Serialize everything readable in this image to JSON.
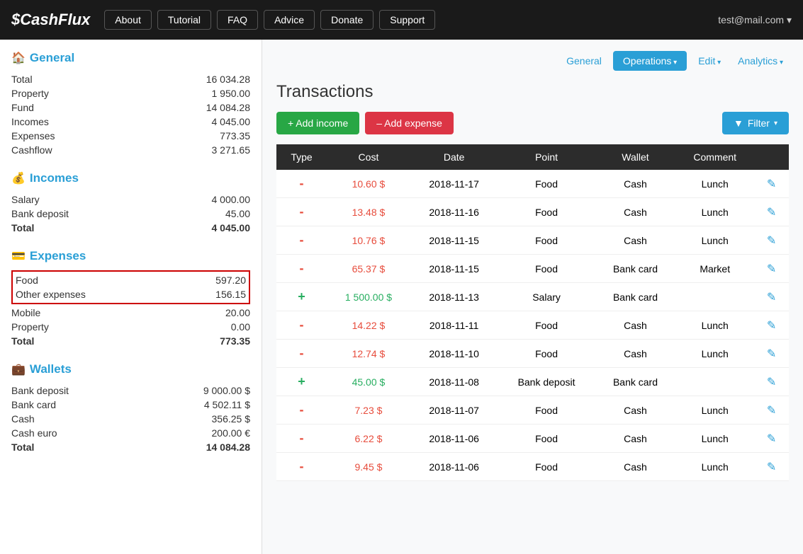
{
  "header": {
    "logo_symbol": "$",
    "logo_text": "CashFlux",
    "nav_items": [
      "About",
      "Tutorial",
      "FAQ",
      "Advice",
      "Donate",
      "Support"
    ],
    "user_email": "test@mail.com"
  },
  "top_nav": {
    "general_label": "General",
    "operations_label": "Operations",
    "edit_label": "Edit",
    "analytics_label": "Analytics"
  },
  "sidebar": {
    "general_title": "General",
    "general_icon": "🏠",
    "general_rows": [
      {
        "label": "Total",
        "value": "16 034.28"
      },
      {
        "label": "Property",
        "value": "1 950.00"
      },
      {
        "label": "Fund",
        "value": "14 084.28"
      },
      {
        "label": "Incomes",
        "value": "4 045.00"
      },
      {
        "label": "Expenses",
        "value": "773.35"
      },
      {
        "label": "Cashflow",
        "value": "3 271.65"
      }
    ],
    "incomes_title": "Incomes",
    "incomes_icon": "💰",
    "incomes_rows": [
      {
        "label": "Salary",
        "value": "4 000.00"
      },
      {
        "label": "Bank deposit",
        "value": "45.00"
      },
      {
        "label": "Total",
        "value": "4 045.00",
        "bold": true
      }
    ],
    "expenses_title": "Expenses",
    "expenses_icon": "💳",
    "expenses_rows": [
      {
        "label": "Food",
        "value": "597.20",
        "highlight": true
      },
      {
        "label": "Other expenses",
        "value": "156.15",
        "highlight": true
      },
      {
        "label": "Mobile",
        "value": "20.00"
      },
      {
        "label": "Property",
        "value": "0.00"
      },
      {
        "label": "Total",
        "value": "773.35",
        "bold": true
      }
    ],
    "wallets_title": "Wallets",
    "wallets_icon": "💼",
    "wallets_rows": [
      {
        "label": "Bank deposit",
        "value": "9 000.00 $"
      },
      {
        "label": "Bank card",
        "value": "4 502.11 $"
      },
      {
        "label": "Cash",
        "value": "356.25 $"
      },
      {
        "label": "Cash euro",
        "value": "200.00 €"
      },
      {
        "label": "Total",
        "value": "14 084.28",
        "bold": true
      }
    ]
  },
  "transactions": {
    "title": "Transactions",
    "add_income_label": "+ Add income",
    "add_expense_label": "– Add expense",
    "filter_label": "Filter",
    "columns": [
      "Type",
      "Cost",
      "Date",
      "Point",
      "Wallet",
      "Comment"
    ],
    "rows": [
      {
        "type": "-",
        "cost": "10.60 $",
        "cost_type": "negative",
        "date": "2018-11-17",
        "point": "Food",
        "wallet": "Cash",
        "comment": "Lunch"
      },
      {
        "type": "-",
        "cost": "13.48 $",
        "cost_type": "negative",
        "date": "2018-11-16",
        "point": "Food",
        "wallet": "Cash",
        "comment": "Lunch"
      },
      {
        "type": "-",
        "cost": "10.76 $",
        "cost_type": "negative",
        "date": "2018-11-15",
        "point": "Food",
        "wallet": "Cash",
        "comment": "Lunch"
      },
      {
        "type": "-",
        "cost": "65.37 $",
        "cost_type": "negative",
        "date": "2018-11-15",
        "point": "Food",
        "wallet": "Bank card",
        "comment": "Market"
      },
      {
        "type": "+",
        "cost": "1 500.00 $",
        "cost_type": "positive",
        "date": "2018-11-13",
        "point": "Salary",
        "wallet": "Bank card",
        "comment": ""
      },
      {
        "type": "-",
        "cost": "14.22 $",
        "cost_type": "negative",
        "date": "2018-11-11",
        "point": "Food",
        "wallet": "Cash",
        "comment": "Lunch"
      },
      {
        "type": "-",
        "cost": "12.74 $",
        "cost_type": "negative",
        "date": "2018-11-10",
        "point": "Food",
        "wallet": "Cash",
        "comment": "Lunch"
      },
      {
        "type": "+",
        "cost": "45.00 $",
        "cost_type": "positive",
        "date": "2018-11-08",
        "point": "Bank deposit",
        "wallet": "Bank card",
        "comment": ""
      },
      {
        "type": "-",
        "cost": "7.23 $",
        "cost_type": "negative",
        "date": "2018-11-07",
        "point": "Food",
        "wallet": "Cash",
        "comment": "Lunch"
      },
      {
        "type": "-",
        "cost": "6.22 $",
        "cost_type": "negative",
        "date": "2018-11-06",
        "point": "Food",
        "wallet": "Cash",
        "comment": "Lunch"
      },
      {
        "type": "-",
        "cost": "9.45 $",
        "cost_type": "negative",
        "date": "2018-11-06",
        "point": "Food",
        "wallet": "Cash",
        "comment": "Lunch"
      }
    ]
  }
}
